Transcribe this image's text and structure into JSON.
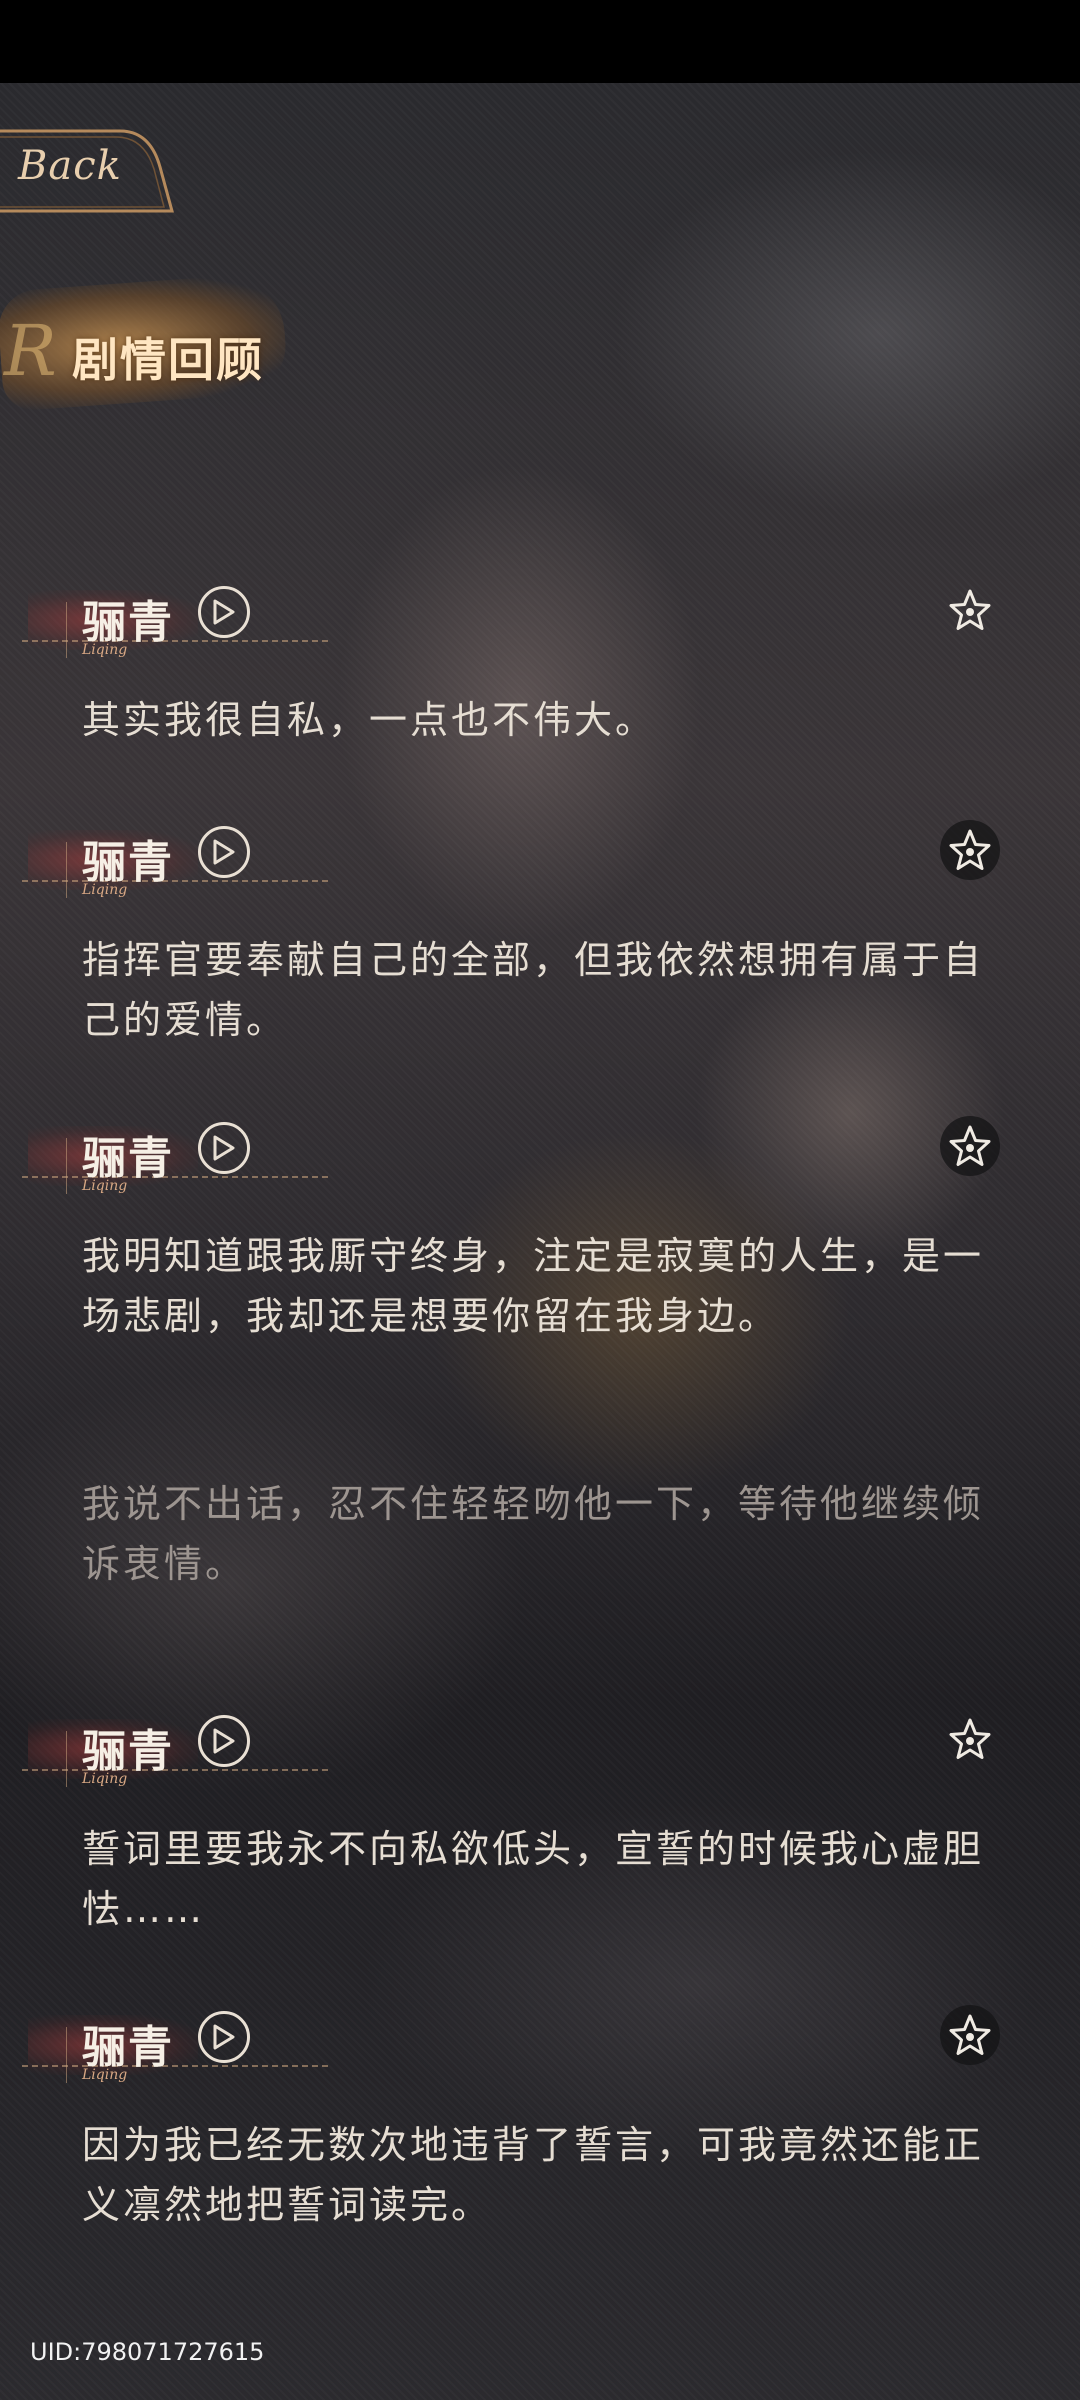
{
  "nav": {
    "back_label": "Back"
  },
  "header": {
    "title": "剧情回顾",
    "title_deco": "R"
  },
  "entries": [
    {
      "speaker": "骊青",
      "speaker_roman": "Liqing",
      "text": "其实我很自私，一点也不伟大。",
      "favorited": false
    },
    {
      "speaker": "骊青",
      "speaker_roman": "Liqing",
      "text": "指挥官要奉献自己的全部，但我依然想拥有属于自己的爱情。",
      "favorited": true
    },
    {
      "speaker": "骊青",
      "speaker_roman": "Liqing",
      "text": "我明知道跟我厮守终身，注定是寂寞的人生，是一场悲剧，我却还是想要你留在我身边。",
      "favorited": true
    },
    {
      "speaker": "",
      "speaker_roman": "",
      "text": "我说不出话，忍不住轻轻吻他一下，等待他继续倾诉衷情。",
      "narration": true
    },
    {
      "speaker": "骊青",
      "speaker_roman": "Liqing",
      "text": "誓词里要我永不向私欲低头，宣誓的时候我心虚胆怯……",
      "favorited": false
    },
    {
      "speaker": "骊青",
      "speaker_roman": "Liqing",
      "text": "因为我已经无数次地违背了誓言，可我竟然还能正义凛然地把誓词读完。",
      "favorited": true
    }
  ],
  "footer": {
    "uid": "UID:798071727615"
  },
  "colors": {
    "accent_gold": "#e8cfae",
    "text": "#e6ded3",
    "narration": "#9d9590"
  }
}
